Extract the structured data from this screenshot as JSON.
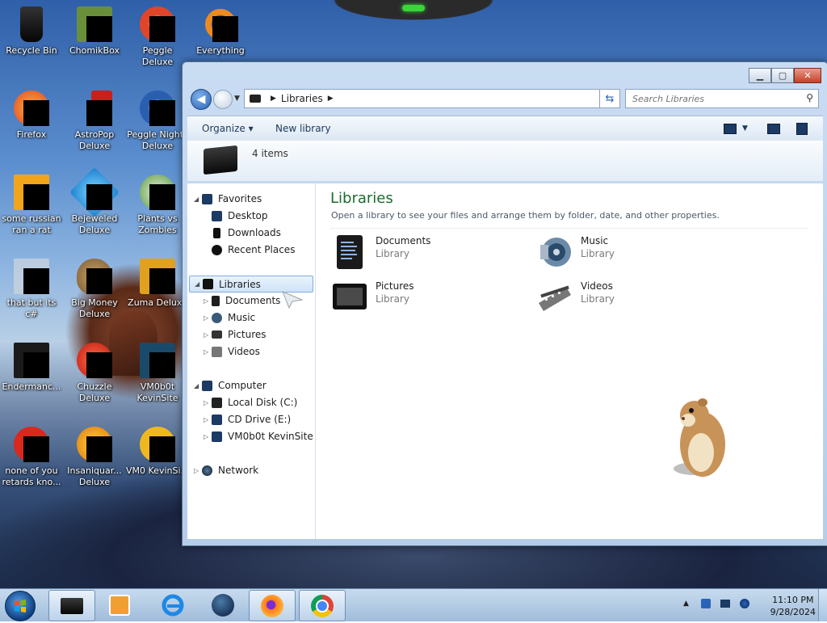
{
  "desktop": {
    "icons": [
      {
        "label": "Recycle Bin"
      },
      {
        "label": "ChomikBox"
      },
      {
        "label": "Peggle Deluxe"
      },
      {
        "label": "Everything"
      },
      {
        "label": "Firefox"
      },
      {
        "label": "AstroPop Deluxe"
      },
      {
        "label": "Peggle Nights Deluxe"
      },
      {
        "label": "some russian ran a rat"
      },
      {
        "label": "Bejeweled Deluxe"
      },
      {
        "label": "Plants vs Zombies"
      },
      {
        "label": "that but its c#"
      },
      {
        "label": "Big Money Deluxe"
      },
      {
        "label": "Zuma Deluxe"
      },
      {
        "label": "Endermanc..."
      },
      {
        "label": "Chuzzle Deluxe"
      },
      {
        "label": "VM0b0t KevinSite"
      },
      {
        "label": "none of you retards kno..."
      },
      {
        "label": "Insaniquar... Deluxe"
      },
      {
        "label": "VM0 KevinSi..."
      }
    ]
  },
  "explorer": {
    "address": {
      "crumb": "Libraries"
    },
    "search": {
      "placeholder": "Search Libraries"
    },
    "toolbar": {
      "organize": "Organize",
      "new_library": "New library"
    },
    "details": {
      "count": "4 items"
    },
    "nav": {
      "favorites": "Favorites",
      "desktop": "Desktop",
      "downloads": "Downloads",
      "recent": "Recent Places",
      "libraries": "Libraries",
      "documents": "Documents",
      "music": "Music",
      "pictures": "Pictures",
      "videos": "Videos",
      "computer": "Computer",
      "local_disk": "Local Disk (C:)",
      "cd_drive": "CD Drive (E:)",
      "vm": "VM0b0t KevinSite",
      "network": "Network"
    },
    "content": {
      "title": "Libraries",
      "subtitle": "Open a library to see your files and arrange them by folder, date, and other properties.",
      "items": [
        {
          "name": "Documents",
          "type": "Library"
        },
        {
          "name": "Music",
          "type": "Library"
        },
        {
          "name": "Pictures",
          "type": "Library"
        },
        {
          "name": "Videos",
          "type": "Library"
        }
      ]
    }
  },
  "taskbar": {
    "time": "11:10 PM",
    "date": "9/28/2024"
  }
}
